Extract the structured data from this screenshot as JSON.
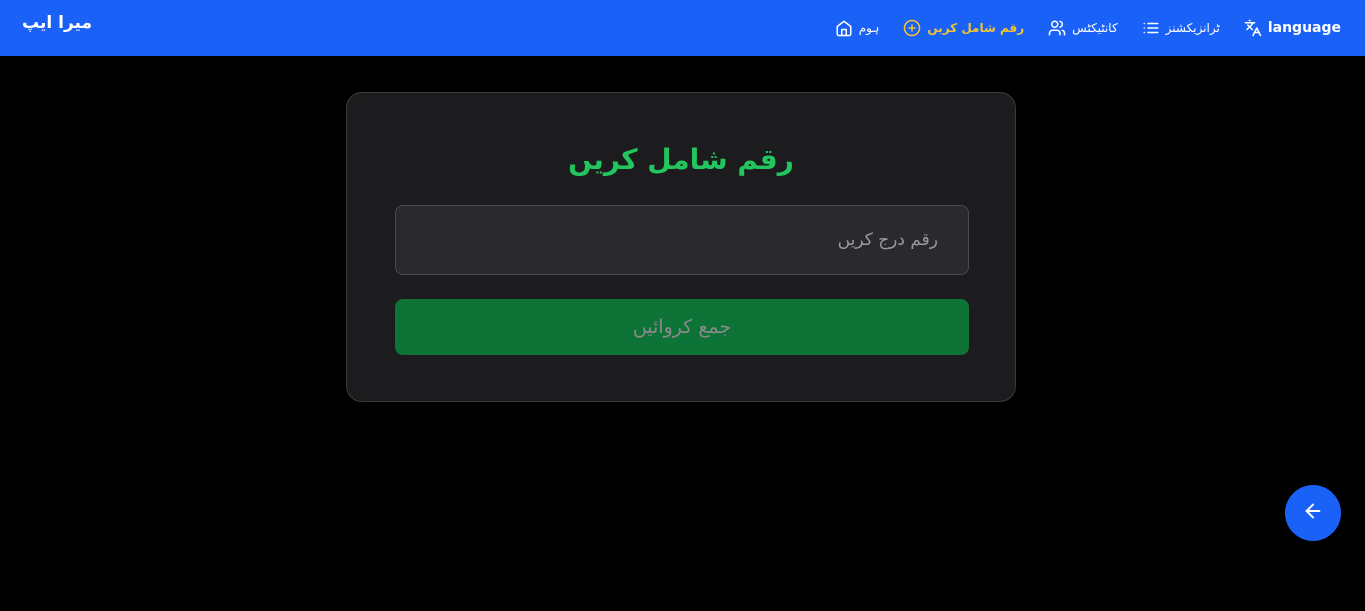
{
  "header": {
    "brand": "میرا ایپ",
    "nav": [
      {
        "id": "language",
        "label": "language",
        "icon": "translate-icon"
      },
      {
        "id": "transactions",
        "label": "ٹرانزیکشنز",
        "icon": "list-icon"
      },
      {
        "id": "contacts",
        "label": "کانٹیکٹس",
        "icon": "users-icon"
      },
      {
        "id": "add-amount",
        "label": "رقم شامل کریں",
        "icon": "plus-circle-icon",
        "active": true
      },
      {
        "id": "home",
        "label": "ہوم",
        "icon": "home-icon"
      }
    ]
  },
  "form": {
    "title": "رقم شامل کریں",
    "amount_placeholder": "رقم درج کریں",
    "amount_value": "",
    "submit_label": "جمع کروائیں"
  },
  "fab": {
    "icon": "arrow-left-icon"
  },
  "colors": {
    "topbar": "#1a62f7",
    "active_nav": "#f4c430",
    "title": "#22c55e",
    "button": "#0d7337",
    "background": "#000000",
    "card": "#1c1c1e"
  }
}
